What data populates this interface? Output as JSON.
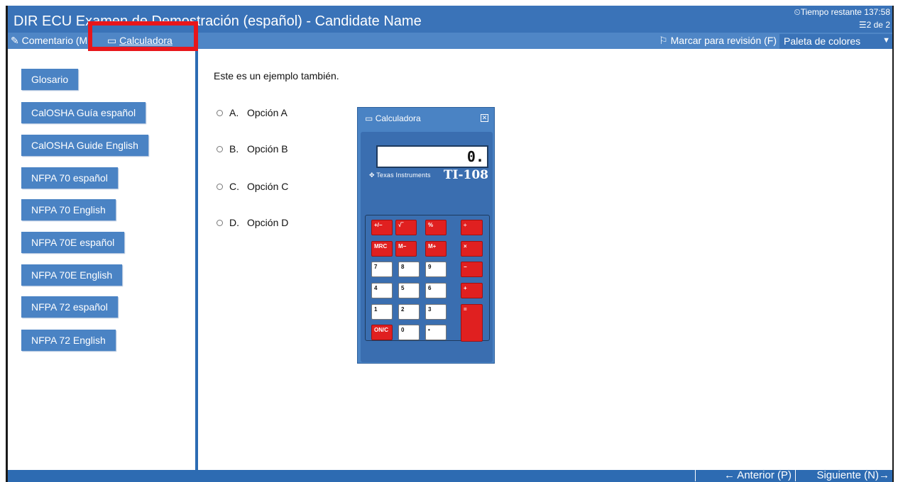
{
  "header": {
    "title": "DIR ECU Examen de Demostración (español) - Candidate Name",
    "timer": "Tiempo restante 137:58",
    "question_count": "2 de 2"
  },
  "toolbar": {
    "comment": "Comentario (M",
    "calculator": "Calculadora",
    "mark_review": "Marcar para revisión (F)",
    "palette": "Paleta de colores"
  },
  "sidebar": {
    "items": [
      {
        "label": "Glosario"
      },
      {
        "label": "CalOSHA Guía español"
      },
      {
        "label": "CalOSHA Guide English"
      },
      {
        "label": "NFPA 70 español"
      },
      {
        "label": "NFPA 70 English"
      },
      {
        "label": "NFPA 70E español"
      },
      {
        "label": "NFPA 70E English"
      },
      {
        "label": "NFPA 72 español"
      },
      {
        "label": "NFPA 72 English"
      }
    ]
  },
  "question": {
    "text": "Este es un ejemplo también.",
    "options": [
      {
        "letter": "A.",
        "label": "Opción A"
      },
      {
        "letter": "B.",
        "label": "Opción B"
      },
      {
        "letter": "C.",
        "label": "Opción C"
      },
      {
        "letter": "D.",
        "label": "Opción D"
      }
    ]
  },
  "calculator": {
    "title": "Calculadora",
    "display": "0.",
    "brand": "Texas Instruments",
    "model": "TI-108",
    "keys": {
      "plusminus": "+/−",
      "sqrt": "√‾",
      "percent": "%",
      "divide": "÷",
      "mrc": "MRC",
      "mminus": "M−",
      "mplus": "M+",
      "multiply": "×",
      "k7": "7",
      "k8": "8",
      "k9": "9",
      "minus": "−",
      "k4": "4",
      "k5": "5",
      "k6": "6",
      "plus": "+",
      "k1": "1",
      "k2": "2",
      "k3": "3",
      "equals": "=",
      "onc": "ON/C",
      "k0": "0",
      "dot": "•"
    }
  },
  "footer": {
    "previous": "← Anterior (P)",
    "next": "Siguiente (N)→"
  },
  "colors": {
    "title_bar": "#3a73b8",
    "toolbar": "#4f86c6",
    "accent": "#2c6cb3",
    "highlight": "#e8161b",
    "calc_key_red": "#e02020"
  }
}
